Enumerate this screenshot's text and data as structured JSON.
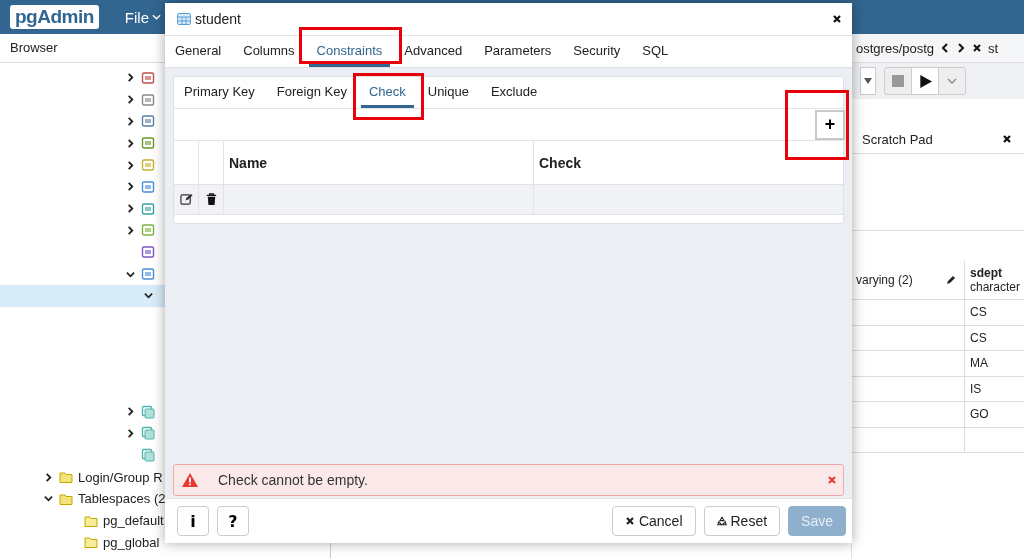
{
  "app": {
    "logo": "pgAdmin",
    "menu": [
      {
        "label": "File"
      }
    ]
  },
  "browser": {
    "title": "Browser",
    "schema_items": [
      {
        "kind": "node",
        "expanded": false
      },
      {
        "kind": "node",
        "expanded": false
      },
      {
        "kind": "node",
        "expanded": false
      },
      {
        "kind": "node",
        "expanded": false
      },
      {
        "kind": "node",
        "expanded": false
      },
      {
        "kind": "node",
        "expanded": false
      },
      {
        "kind": "node",
        "expanded": false
      },
      {
        "kind": "node",
        "expanded": false
      },
      {
        "kind": "leaf"
      },
      {
        "kind": "node",
        "expanded": true,
        "children": [
          {
            "kind": "node",
            "expanded": true,
            "selected": true
          }
        ]
      }
    ],
    "schema_items_after": [
      {
        "kind": "node",
        "expanded": false
      },
      {
        "kind": "node",
        "expanded": false
      },
      {
        "kind": "leaf"
      }
    ],
    "server_items": [
      {
        "label": "Login/Group R",
        "kind": "node",
        "expanded": false
      },
      {
        "label": "Tablespaces (2",
        "kind": "node",
        "expanded": true,
        "children": [
          {
            "label": "pg_default"
          },
          {
            "label": "pg_global"
          }
        ]
      }
    ]
  },
  "query_tool": {
    "breadcrumb": "ostgres/postg",
    "tab_fragment": "st",
    "scratch_pad": "Scratch Pad",
    "grid": {
      "column_type_fragment": "varying (2)",
      "column": {
        "name": "sdept",
        "type": "character"
      },
      "rows": [
        "CS",
        "CS",
        "MA",
        "IS",
        "GO"
      ]
    }
  },
  "dialog": {
    "title": "student",
    "tabs": [
      {
        "label": "General",
        "selected": false,
        "highlighted": false
      },
      {
        "label": "Columns",
        "selected": false,
        "highlighted": false
      },
      {
        "label": "Constraints",
        "selected": true,
        "highlighted": true
      },
      {
        "label": "Advanced",
        "selected": false,
        "highlighted": false
      },
      {
        "label": "Parameters",
        "selected": false,
        "highlighted": false
      },
      {
        "label": "Security",
        "selected": false,
        "highlighted": false
      },
      {
        "label": "SQL",
        "selected": false,
        "highlighted": false
      }
    ],
    "subtabs": [
      {
        "label": "Primary Key",
        "selected": false,
        "highlighted": false
      },
      {
        "label": "Foreign Key",
        "selected": false,
        "highlighted": false
      },
      {
        "label": "Check",
        "selected": true,
        "highlighted": true
      },
      {
        "label": "Unique",
        "selected": false,
        "highlighted": false
      },
      {
        "label": "Exclude",
        "selected": false,
        "highlighted": false
      }
    ],
    "add_button": {
      "label": "+",
      "highlighted": true
    },
    "table": {
      "columns": [
        "Name",
        "Check"
      ],
      "rows": [
        {
          "selected": false
        }
      ]
    },
    "alert": {
      "kind": "error",
      "message": "Check cannot be empty."
    },
    "help_buttons": [
      "i",
      "?"
    ],
    "buttons": [
      {
        "label": "Cancel",
        "kind": "cancel",
        "disabled": false
      },
      {
        "label": "Reset",
        "kind": "reset",
        "disabled": false
      },
      {
        "label": "Save",
        "kind": "save",
        "disabled": true
      }
    ]
  }
}
